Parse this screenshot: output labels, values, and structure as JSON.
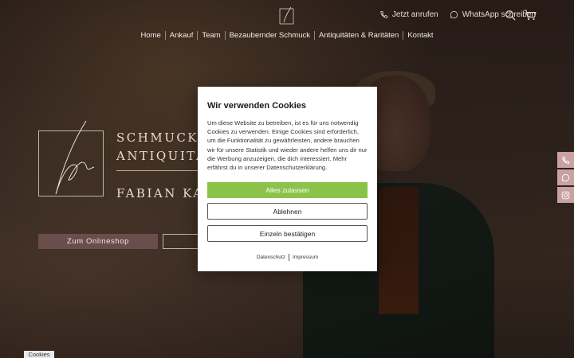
{
  "header": {
    "call_label": "Jetzt anrufen",
    "whatsapp_label": "WhatsApp schreiben"
  },
  "nav": {
    "items": [
      "Home",
      "Ankauf",
      "Team",
      "Bezaubernder Schmuck",
      "Antiquitäten & Raritäten",
      "Kontakt"
    ]
  },
  "hero": {
    "line1": "SCHMUCK",
    "line2": "ANTIQUITÄ",
    "line3": "FABIAN KA",
    "shop_button": "Zum Onlineshop"
  },
  "cookie_modal": {
    "title": "Wir verwenden Cookies",
    "body": "Um diese Website zu betreiben, ist es für uns notwendig Cookies zu verwenden. Einige Cookies sind erforderlich, um die Funktionalität zu gewährleisten, andere brauchen wir für unsere Statistik und wieder andere helfen uns dir nur die Werbung anzuzeigen, die dich interessiert. Mehr erfährst du in unserer Datenschutzerklärung.",
    "accept_all": "Alles zulassen",
    "reject": "Ablehnen",
    "confirm_individual": "Einzeln bestätigen",
    "privacy_link": "Datenschutz",
    "imprint_link": "Impressum"
  },
  "cookie_pill": "Cookies",
  "colors": {
    "accept_green": "#8bc34a",
    "shop_button": "#6a4e4c",
    "social_pink": "#c9a0a4"
  },
  "icons": [
    "logo-mark-icon",
    "phone-icon",
    "whatsapp-icon",
    "search-icon",
    "cart-icon",
    "instagram-icon"
  ]
}
